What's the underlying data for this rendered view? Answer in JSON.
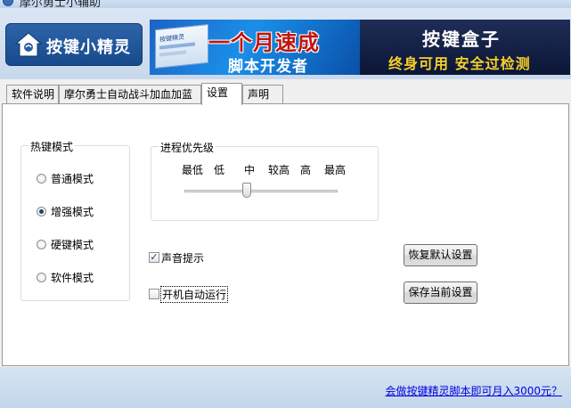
{
  "window": {
    "title": "摩尔勇士小辅助"
  },
  "header": {
    "logo_text": "按键小精灵",
    "ad_left_headline": "一个月速成",
    "ad_left_sub": "脚本开发者",
    "ad_box_text": "按键精灵",
    "ad_right_title": "按键盒子",
    "ad_right_slogan": "终身可用  安全过检测"
  },
  "tabs": [
    {
      "label": "软件说明"
    },
    {
      "label": "摩尔勇士自动战斗加血加蓝"
    },
    {
      "label": "设置",
      "active": true
    },
    {
      "label": "声明"
    }
  ],
  "hotkey_group": {
    "title": "热键模式",
    "options": [
      {
        "label": "普通模式",
        "checked": false
      },
      {
        "label": "增强模式",
        "checked": true
      },
      {
        "label": "硬键模式",
        "checked": false
      },
      {
        "label": "软件模式",
        "checked": false
      }
    ]
  },
  "priority_group": {
    "title": "进程优先级",
    "ticks": [
      "最低",
      "低",
      "中",
      "较高",
      "高",
      "最高"
    ],
    "selected": "中"
  },
  "options": {
    "sound_label": "声音提示",
    "sound_checked": true,
    "autostart_label": "开机自动运行",
    "autostart_checked": false
  },
  "buttons": {
    "restore_default": "恢复默认设置",
    "save_current": "保存当前设置"
  },
  "footer": {
    "link": "会做按键精灵脚本即可月入3000元？"
  }
}
